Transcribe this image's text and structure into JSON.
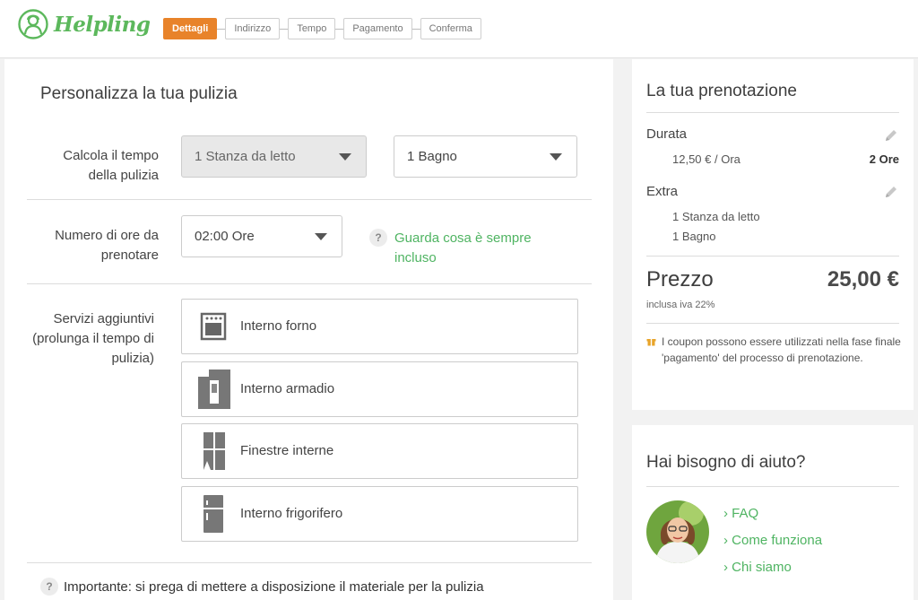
{
  "brand": {
    "name": "Helpling",
    "color": "#5cb85c",
    "logo_icon": "helpling-mascot-icon"
  },
  "steps": [
    "Dettagli",
    "Indirizzo",
    "Tempo",
    "Pagamento",
    "Conferma"
  ],
  "active_step": "Dettagli",
  "main": {
    "title": "Personalizza la tua pulizia",
    "calc_label": "Calcola il tempo della pulizia",
    "bedroom_select": "1 Stanza da letto",
    "bathroom_select": "1 Bagno",
    "hours_label": "Numero di ore da prenotare",
    "hours_select": "02:00 Ore",
    "help_link": "Guarda cosa è sempre incluso",
    "services_label": "Servizi aggiuntivi (prolunga il tempo di pulizia)",
    "services": [
      {
        "label": "Interno forno",
        "icon": "oven-icon"
      },
      {
        "label": "Interno armadio",
        "icon": "wardrobe-icon"
      },
      {
        "label": "Finestre interne",
        "icon": "window-icon"
      },
      {
        "label": "Interno frigorifero",
        "icon": "fridge-icon"
      }
    ],
    "notice": "Importante: si prega di mettere a disposizione il materiale per la pulizia"
  },
  "booking": {
    "title": "La tua prenotazione",
    "duration_label": "Durata",
    "rate": "12,50 € / Ora",
    "duration_value": "2 Ore",
    "extra_label": "Extra",
    "extras": [
      "1 Stanza da letto",
      "1 Bagno"
    ],
    "price_label": "Prezzo",
    "price_value": "25,00 €",
    "vat": "inclusa iva 22%",
    "coupon_note": "I coupon possono essere utilizzati nella fase finale 'pagamento' del processo di prenotazione."
  },
  "help": {
    "title": "Hai bisogno di aiuto?",
    "links": [
      "› FAQ",
      "› Come funziona",
      "› Chi siamo"
    ]
  },
  "colors": {
    "accent": "#e8832a",
    "link_green": "#4fb462"
  }
}
